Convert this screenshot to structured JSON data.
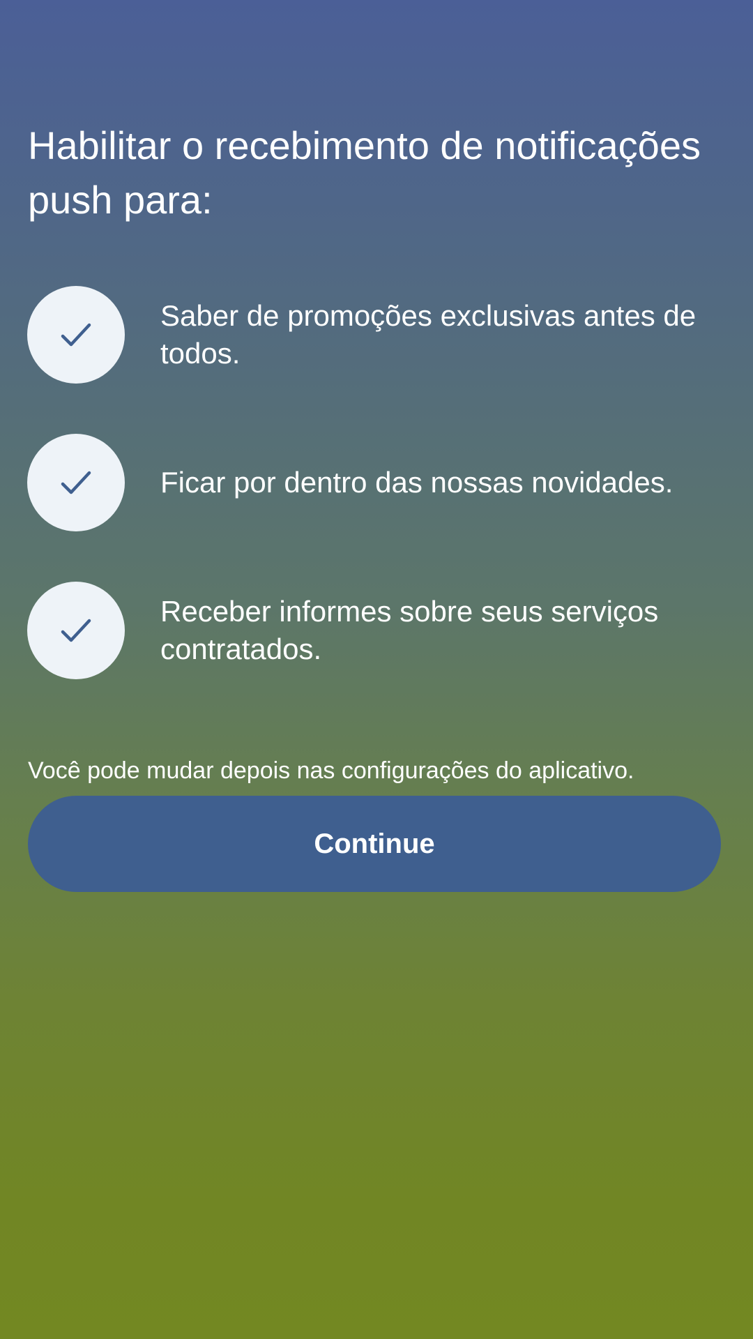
{
  "title": "Habilitar o recebimento de notificações push para:",
  "benefits": [
    {
      "icon": "checkmark-icon",
      "text": "Saber de promoções exclusivas antes de todos."
    },
    {
      "icon": "checkmark-icon",
      "text": "Ficar por dentro das nossas novidades."
    },
    {
      "icon": "checkmark-icon",
      "text": "Receber informes sobre seus serviços contratados."
    }
  ],
  "hint": "Você pode mudar depois nas configurações do aplicativo.",
  "continue_label": "Continue",
  "colors": {
    "gradient_top": "#4b5f97",
    "gradient_bottom": "#738822",
    "button": "#3f5f8f",
    "check_circle": "#eef3f8",
    "check_mark": "#3f5f8f"
  }
}
